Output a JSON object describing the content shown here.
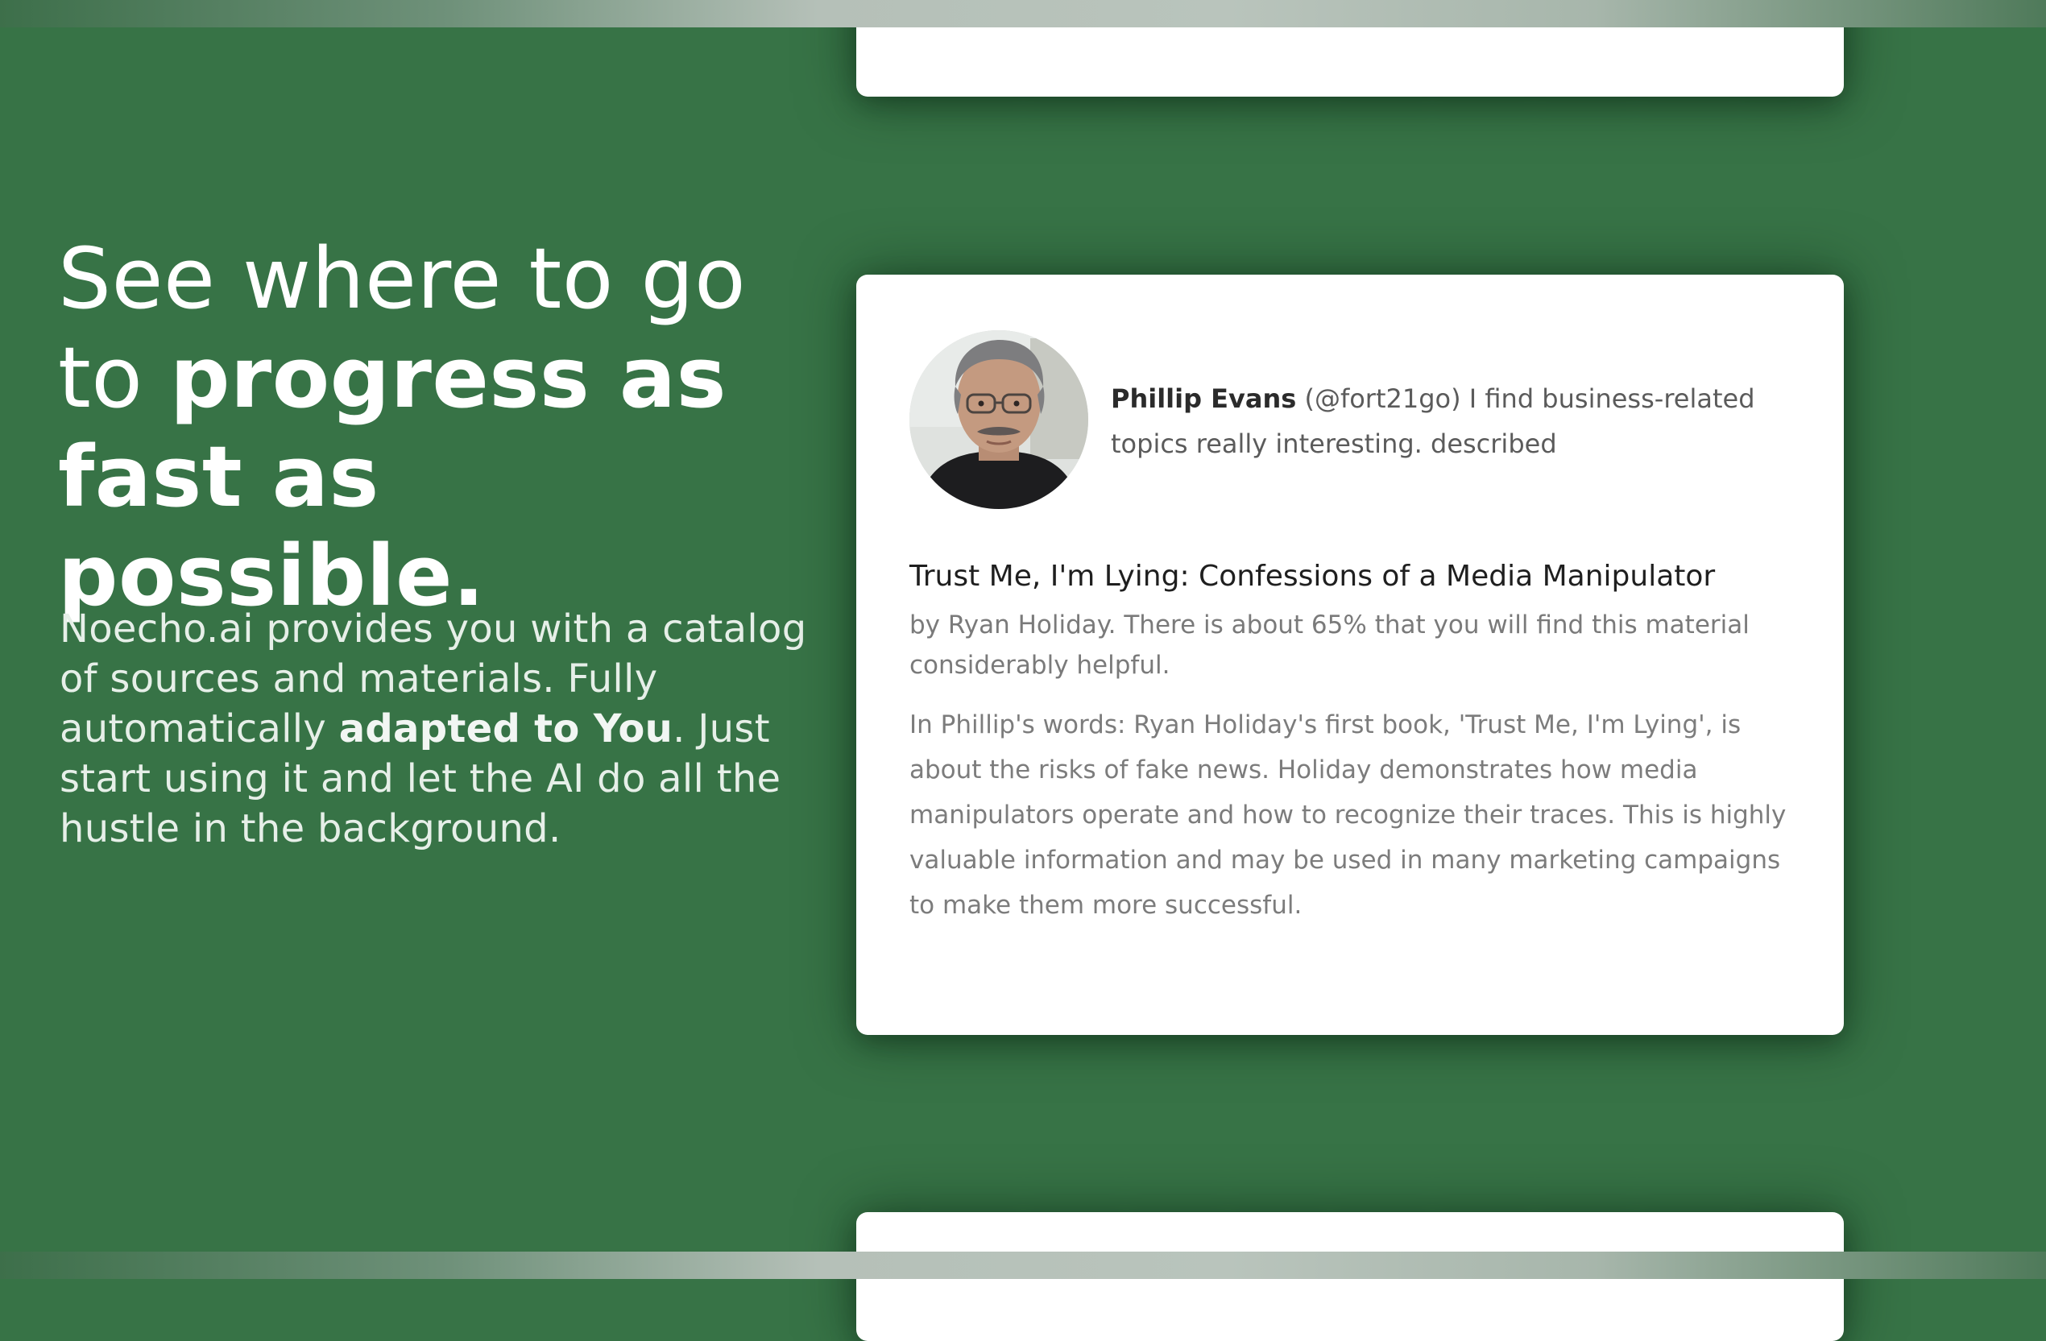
{
  "hero": {
    "headline_lead": "See where to go to ",
    "headline_emphasis": "progress as fast as possible.",
    "intro_part1": "Noecho.ai provides you with a catalog of sources and materials. Fully automatically ",
    "intro_emphasis": "adapted to You",
    "intro_part2": ". Just start using it and let the AI do all the hustle in the background."
  },
  "recommendation": {
    "user": {
      "name": "Phillip Evans",
      "handle": "(@fort21go)",
      "description": "I find business-related topics really interesting. described"
    },
    "book": {
      "title": "Trust Me, I'm Lying: Confessions of a Media Manipulator",
      "meta": "by Ryan Holiday. There is about 65% that you will find this material considerably helpful.",
      "review": "In Phillip's words: Ryan Holiday's first book, 'Trust Me, I'm Lying', is about the risks of fake news. Holiday demonstrates how media manipulators operate and how to recognize their traces. This is highly valuable information and may be used in many marketing campaigns to make them more successful."
    }
  },
  "colors": {
    "background": "#377346",
    "card": "#ffffff",
    "headline_text": "#ffffff"
  }
}
